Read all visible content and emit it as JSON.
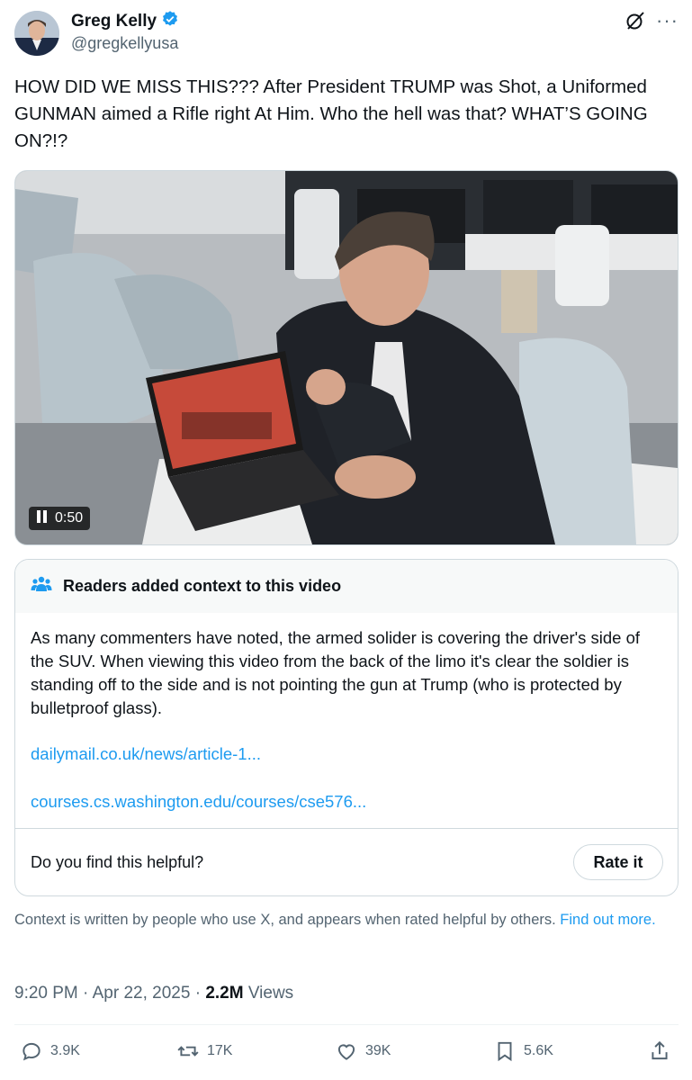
{
  "author": {
    "name": "Greg Kelly",
    "handle": "@gregkellyusa",
    "verified": true
  },
  "icons": {
    "verified": "verified-badge-icon",
    "grok": "grok-icon",
    "more": "more-icon",
    "pause": "pause-icon",
    "community": "community-notes-icon",
    "reply": "reply-icon",
    "repost": "repost-icon",
    "like": "like-icon",
    "bookmark": "bookmark-icon",
    "share": "share-icon"
  },
  "tweet": {
    "text": "HOW DID WE MISS THIS??? After President TRUMP was Shot, a Uniformed GUNMAN aimed a Rifle right At Him.  Who the hell was that? WHAT’S GOING ON?!?"
  },
  "video": {
    "duration": "0:50"
  },
  "context_note": {
    "title": "Readers added context to this video",
    "body": "As many commenters have noted, the armed solider is covering the driver's side of the SUV. When viewing this video from the back of the limo it's clear the soldier is standing off to the side and is not pointing the gun at Trump (who is protected by bulletproof glass).",
    "links": [
      "dailymail.co.uk/news/article-1...",
      "courses.cs.washington.edu/courses/cse576..."
    ],
    "question": "Do you find this helpful?",
    "rate_label": "Rate it"
  },
  "footnote": {
    "text": "Context is written by people who use X, and appears when rated helpful by others. ",
    "link": "Find out more",
    "suffix": "."
  },
  "meta": {
    "time": "9:20 PM",
    "separator": "·",
    "date": "Apr 22, 2025",
    "views_count": "2.2M",
    "views_label": "Views"
  },
  "actions": {
    "replies": "3.9K",
    "reposts": "17K",
    "likes": "39K",
    "bookmarks": "5.6K"
  },
  "colors": {
    "accent": "#1d9bf0",
    "text": "#0f1419",
    "muted": "#536471",
    "border": "#cfd9de"
  }
}
